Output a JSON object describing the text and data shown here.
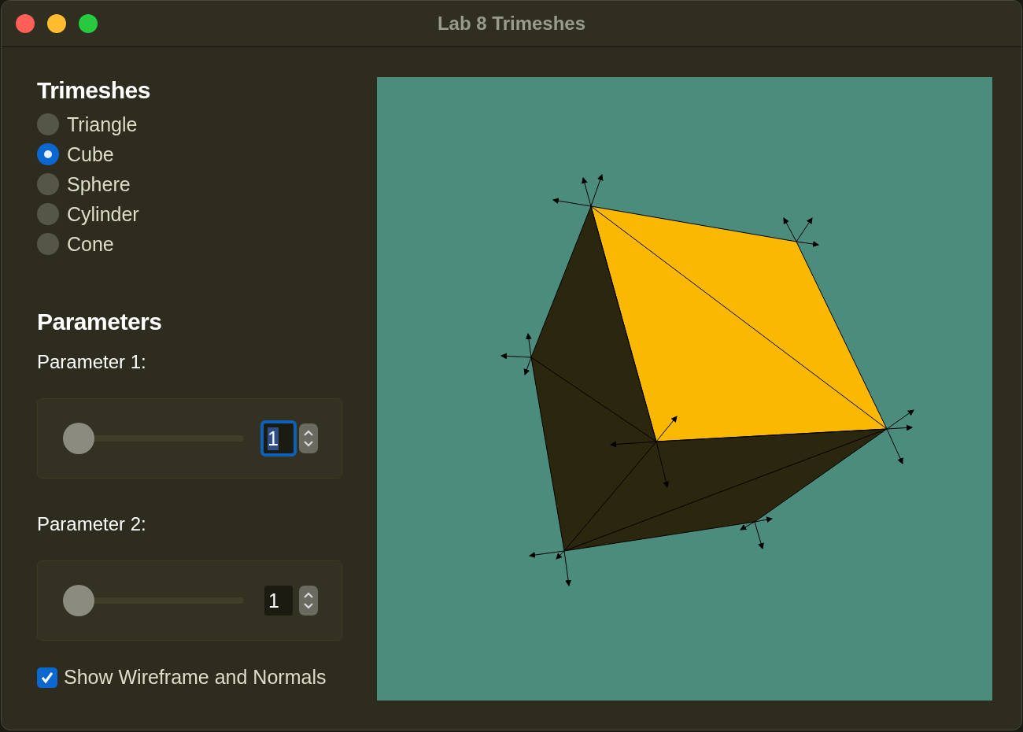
{
  "window": {
    "title": "Lab 8 Trimeshes"
  },
  "trimeshes": {
    "heading": "Trimeshes",
    "options": [
      {
        "label": "Triangle",
        "selected": false
      },
      {
        "label": "Cube",
        "selected": true
      },
      {
        "label": "Sphere",
        "selected": false
      },
      {
        "label": "Cylinder",
        "selected": false
      },
      {
        "label": "Cone",
        "selected": false
      }
    ]
  },
  "parameters": {
    "heading": "Parameters",
    "items": [
      {
        "label": "Parameter 1:",
        "value": "1",
        "level": 0,
        "focused": true
      },
      {
        "label": "Parameter 2:",
        "value": "1",
        "level": 0,
        "focused": false
      }
    ]
  },
  "wireframe": {
    "label": "Show Wireframe and Normals",
    "checked": true
  }
}
